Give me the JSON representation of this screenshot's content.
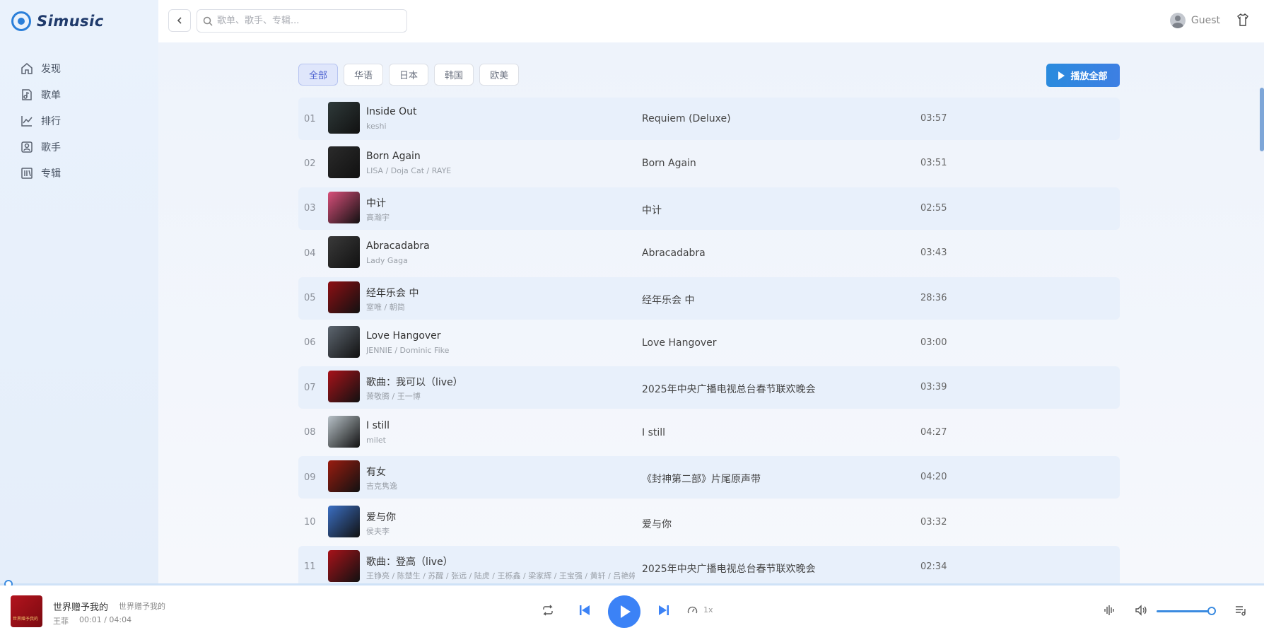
{
  "app": {
    "name": "Simusic"
  },
  "sidebar": {
    "items": [
      {
        "label": "发现",
        "icon": "home-icon"
      },
      {
        "label": "歌单",
        "icon": "playlist-icon"
      },
      {
        "label": "排行",
        "icon": "chart-icon"
      },
      {
        "label": "歌手",
        "icon": "singer-icon"
      },
      {
        "label": "专辑",
        "icon": "album-icon"
      }
    ]
  },
  "header": {
    "search_placeholder": "歌单、歌手、专辑...",
    "user_name": "Guest"
  },
  "filters": [
    "全部",
    "华语",
    "日本",
    "韩国",
    "欧美"
  ],
  "active_filter": "全部",
  "play_all_label": "播放全部",
  "songs": [
    {
      "index": "01",
      "title": "Inside Out",
      "artist": "keshi",
      "album": "Requiem (Deluxe)",
      "duration": "03:57",
      "cover_color": "#2f3a3a"
    },
    {
      "index": "02",
      "title": "Born Again",
      "artist": "LISA / Doja Cat / RAYE",
      "album": "Born Again",
      "duration": "03:51",
      "cover_color": "#2b2b2b"
    },
    {
      "index": "03",
      "title": "中计",
      "artist": "高瀚宇",
      "album": "中计",
      "duration": "02:55",
      "cover_color": "#d94f7a"
    },
    {
      "index": "04",
      "title": "Abracadabra",
      "artist": "Lady Gaga",
      "album": "Abracadabra",
      "duration": "03:43",
      "cover_color": "#3a3a3a"
    },
    {
      "index": "05",
      "title": "经年乐会 中",
      "artist": "室唯 / 朝简",
      "album": "经年乐会 中",
      "duration": "28:36",
      "cover_color": "#8e0f14"
    },
    {
      "index": "06",
      "title": "Love Hangover",
      "artist": "JENNIE / Dominic Fike",
      "album": "Love Hangover",
      "duration": "03:00",
      "cover_color": "#5d6670"
    },
    {
      "index": "07",
      "title": "歌曲：我可以（live）",
      "artist": "萧敬腾 / 王一博",
      "album": "2025年中央广播电视总台春节联欢晚会",
      "duration": "03:39",
      "cover_color": "#a8121a"
    },
    {
      "index": "08",
      "title": "I still",
      "artist": "milet",
      "album": "I still",
      "duration": "04:27",
      "cover_color": "#b8c2c8"
    },
    {
      "index": "09",
      "title": "有女",
      "artist": "吉克隽逸",
      "album": "《封神第二部》片尾原声带",
      "duration": "04:20",
      "cover_color": "#9a1c10"
    },
    {
      "index": "10",
      "title": "爱与你",
      "artist": "侯夫李",
      "album": "爱与你",
      "duration": "03:32",
      "cover_color": "#3b6fc4"
    },
    {
      "index": "11",
      "title": "歌曲：登高（live）",
      "artist": "王铮亮 / 陈楚生 / 苏醒 / 张远 / 陆虎 / 王栎鑫 / 梁家辉 / 王宝强 / 黄轩 / 吕艳婷 / 谭若 / 谢娜娜",
      "album": "2025年中央广播电视总台春节联欢晚会",
      "duration": "02:34",
      "cover_color": "#a8121a"
    }
  ],
  "player": {
    "title": "世界赠予我的",
    "subtitle": "世界赠予我的",
    "artist": "王菲",
    "time": "00:01 / 04:04",
    "speed": "1x",
    "progress_pct": 0.4,
    "volume_pct": 90,
    "cover_text": "世界赠予我的"
  }
}
